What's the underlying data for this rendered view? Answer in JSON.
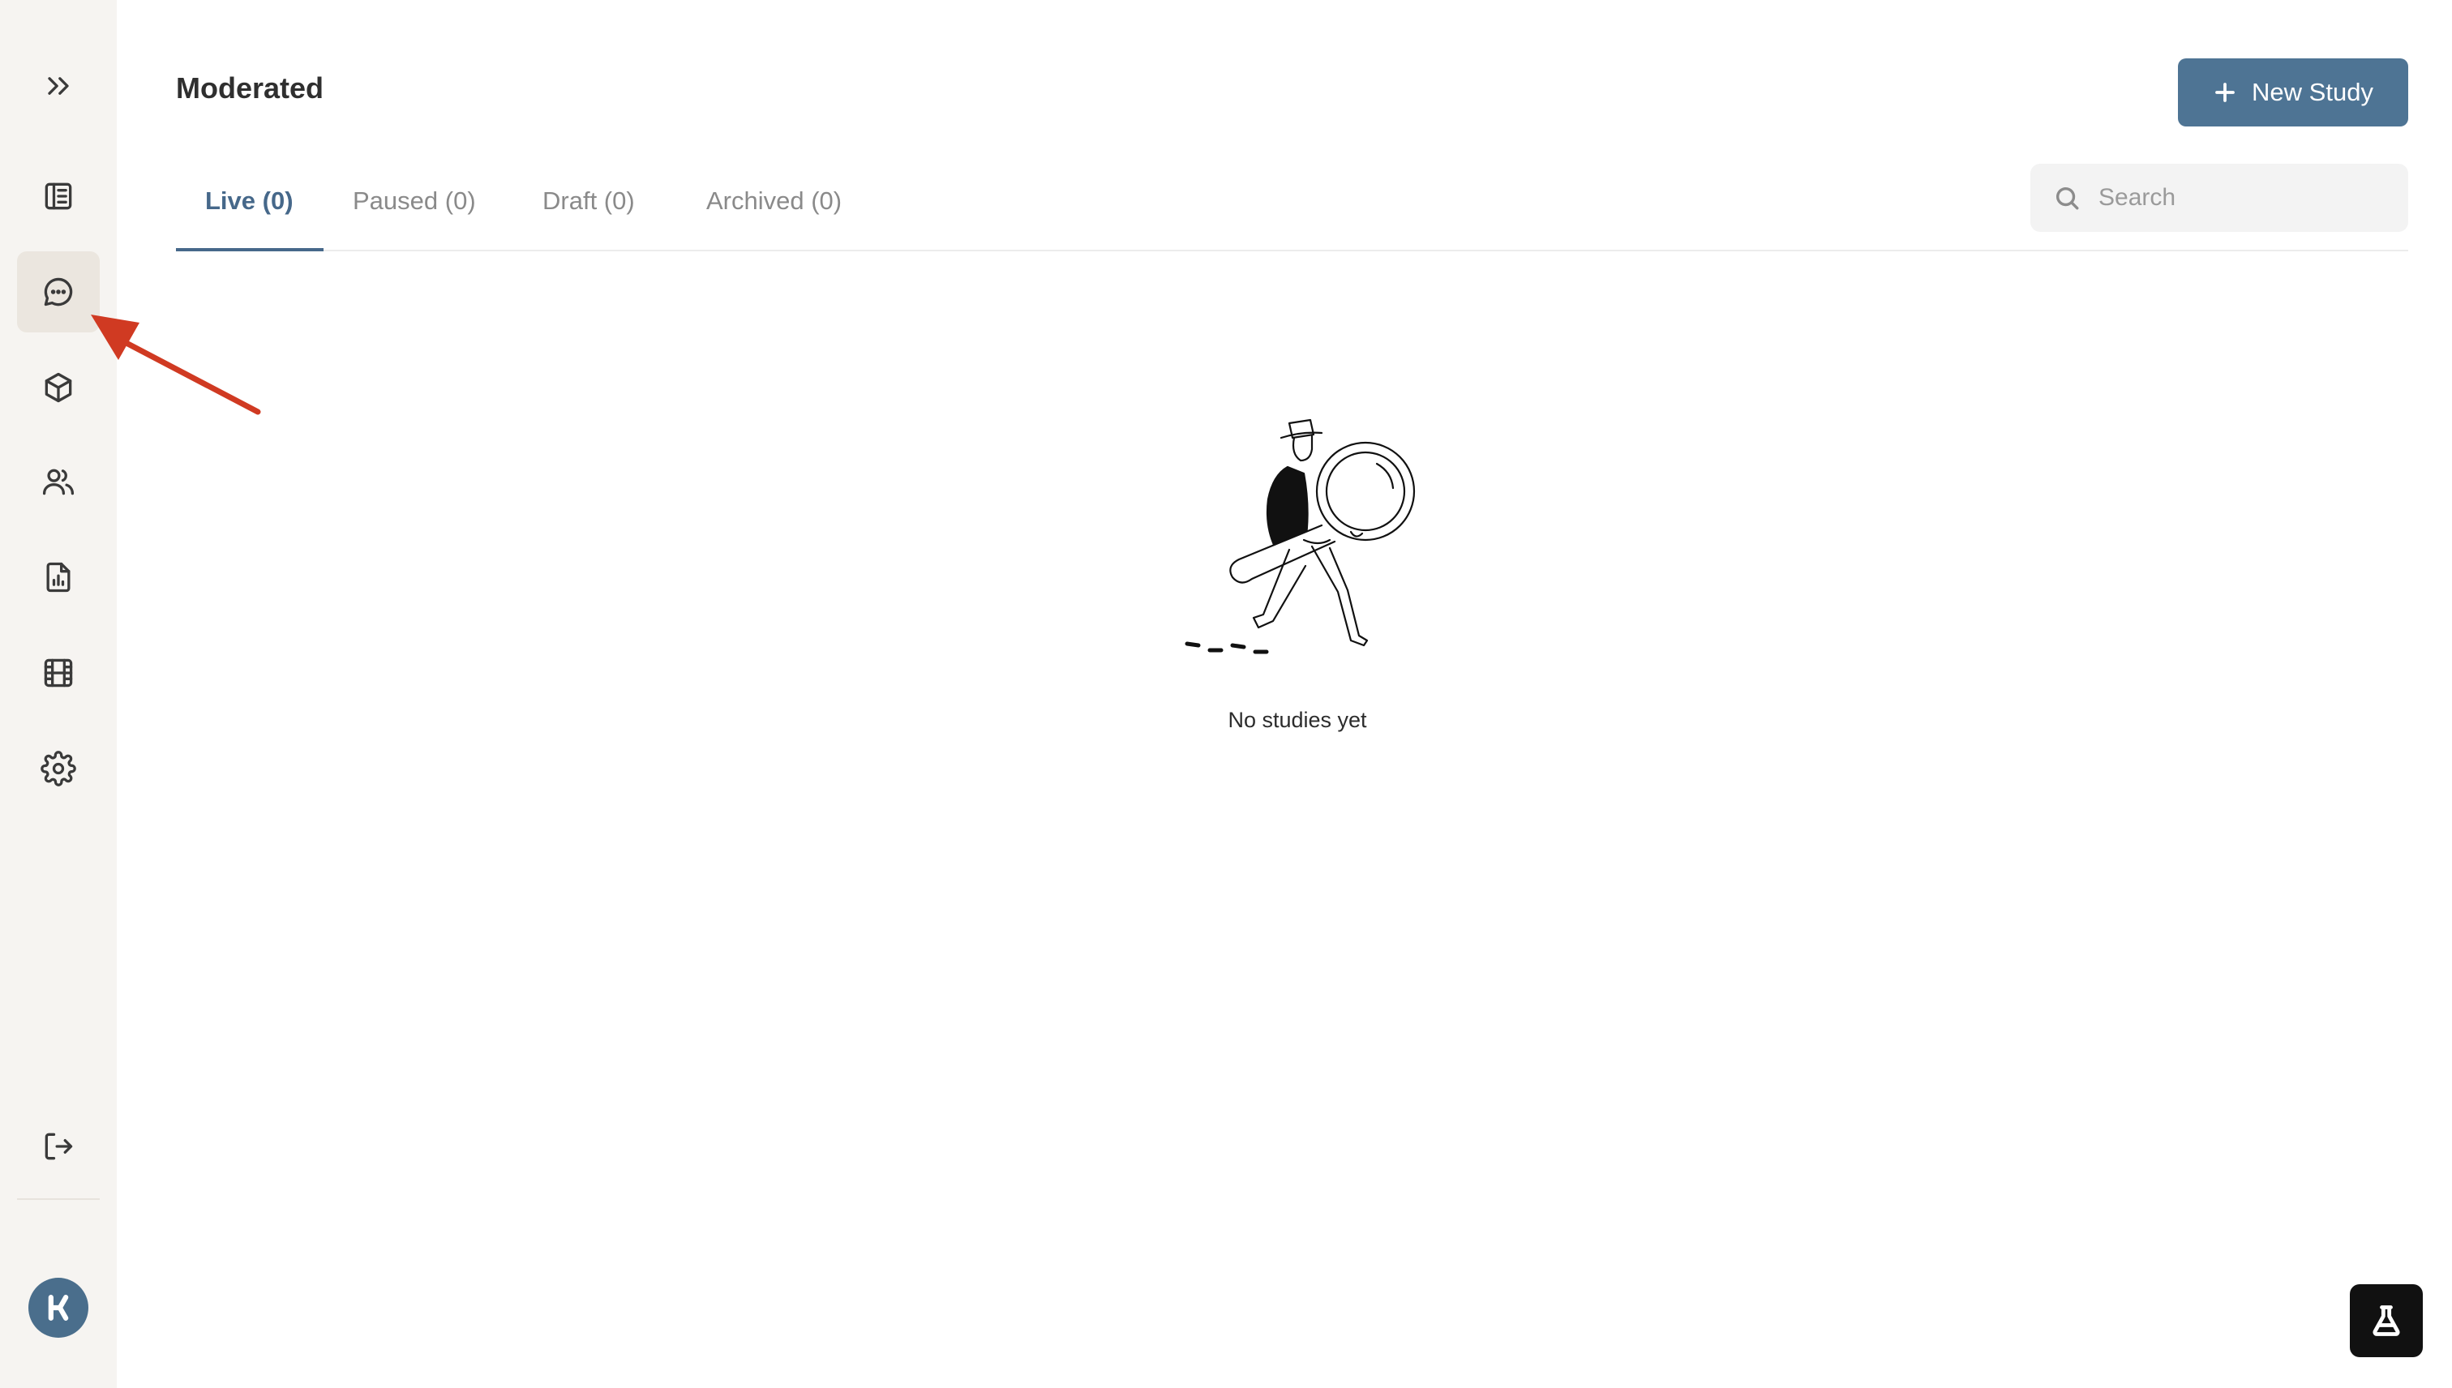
{
  "sidebar": {
    "items": [
      {
        "name": "expand",
        "icon": "chevrons-right-icon"
      },
      {
        "name": "overview",
        "icon": "book-icon"
      },
      {
        "name": "moderated",
        "icon": "chat-bubble-icon",
        "active": true
      },
      {
        "name": "unmoderated",
        "icon": "cube-icon"
      },
      {
        "name": "participants",
        "icon": "users-icon"
      },
      {
        "name": "reports",
        "icon": "report-icon"
      },
      {
        "name": "recordings",
        "icon": "film-icon"
      },
      {
        "name": "settings",
        "icon": "gear-icon"
      },
      {
        "name": "logout",
        "icon": "logout-icon"
      }
    ],
    "avatar_icon": "brand-logo"
  },
  "header": {
    "title": "Moderated",
    "new_study_label": "New Study"
  },
  "tabs": [
    {
      "label": "Live (0)",
      "active": true
    },
    {
      "label": "Paused (0)"
    },
    {
      "label": "Draft (0)"
    },
    {
      "label": "Archived (0)"
    }
  ],
  "search": {
    "placeholder": "Search"
  },
  "empty_state": {
    "message": "No studies yet",
    "illustration": "detective-magnifier-illustration"
  },
  "colors": {
    "accent": "#4e7494",
    "annotation_arrow": "#d03a22",
    "sidebar_bg": "#f6f4f1"
  }
}
